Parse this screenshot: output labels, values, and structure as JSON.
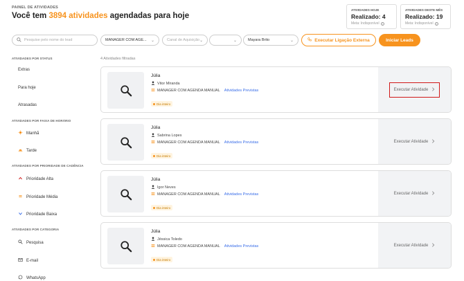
{
  "header": {
    "label": "PAINEL DE ATIVIDADES",
    "title_prefix": "Você tem ",
    "title_count": "3894 atividades",
    "title_suffix": " agendadas para hoje"
  },
  "stats": [
    {
      "label": "ATIVIDADES HOJE",
      "value": "Realizado: 4",
      "meta": "Meta: Indisponível"
    },
    {
      "label": "ATIVIDADES DESTE MÊS",
      "value": "Realizado: 19",
      "meta": "Meta: Indisponível"
    }
  ],
  "filters": {
    "search_placeholder": "Pesquise pelo nome do lead",
    "manager": "MANAGER COM AGE...",
    "canal_placeholder": "Canal de Aquisição",
    "extra": "",
    "owner": "Mayara Brito",
    "call_button": "Executar Ligação Externa",
    "leads_button": "Iniciar Leads"
  },
  "sidebar": {
    "status_title": "ATIVIDADES POR STATUS",
    "status_items": [
      "Extras",
      "Para hoje",
      "Atrasadas"
    ],
    "time_title": "ATIVIDADES POR FAIXA DE HORÁRIO",
    "time_items": [
      "Manhã",
      "Tarde"
    ],
    "priority_title": "ATIVIDADES POR PRIORIDADE DE CADÊNCIA",
    "priority_items": [
      "Prioridade Alta",
      "Prioridade Média",
      "Prioridade Baixa"
    ],
    "category_title": "ATIVIDADES POR CATEGORIA",
    "category_items": [
      "Pesquisa",
      "E-mail",
      "WhatsApp"
    ]
  },
  "main": {
    "count_label": "4 Atividades filtradas",
    "cards": [
      {
        "title": "Júlia",
        "person": "Vitor Miranda",
        "cadence": "MANAGER COM AGENDA MANUAL",
        "link": "Atividades Previstas",
        "badge": "Dia inteiro",
        "action": "Executar Atividade"
      },
      {
        "title": "Júlia",
        "person": "Sabrina Lopes",
        "cadence": "MANAGER COM AGENDA MANUAL",
        "link": "Atividades Previstas",
        "badge": "Dia inteiro",
        "action": "Executar Atividade"
      },
      {
        "title": "Júlia",
        "person": "Igor Neves",
        "cadence": "MANAGER COM AGENDA MANUAL",
        "link": "Atividades Previstas",
        "badge": "Dia inteiro",
        "action": "Executar Atividade"
      },
      {
        "title": "Júlia",
        "person": "Jéssica Toledo",
        "cadence": "MANAGER COM AGENDA MANUAL",
        "link": "Atividades Previstas",
        "badge": "Dia inteiro",
        "action": "Executar Atividade"
      }
    ]
  },
  "colors": {
    "accent": "#f7931e",
    "link": "#3a6ee8",
    "highlight_box": "#d01818"
  },
  "icons": {
    "card_thumb": "search-icon",
    "person": "user-icon",
    "cadence": "list-icon",
    "action": "chevron-right-icon"
  }
}
